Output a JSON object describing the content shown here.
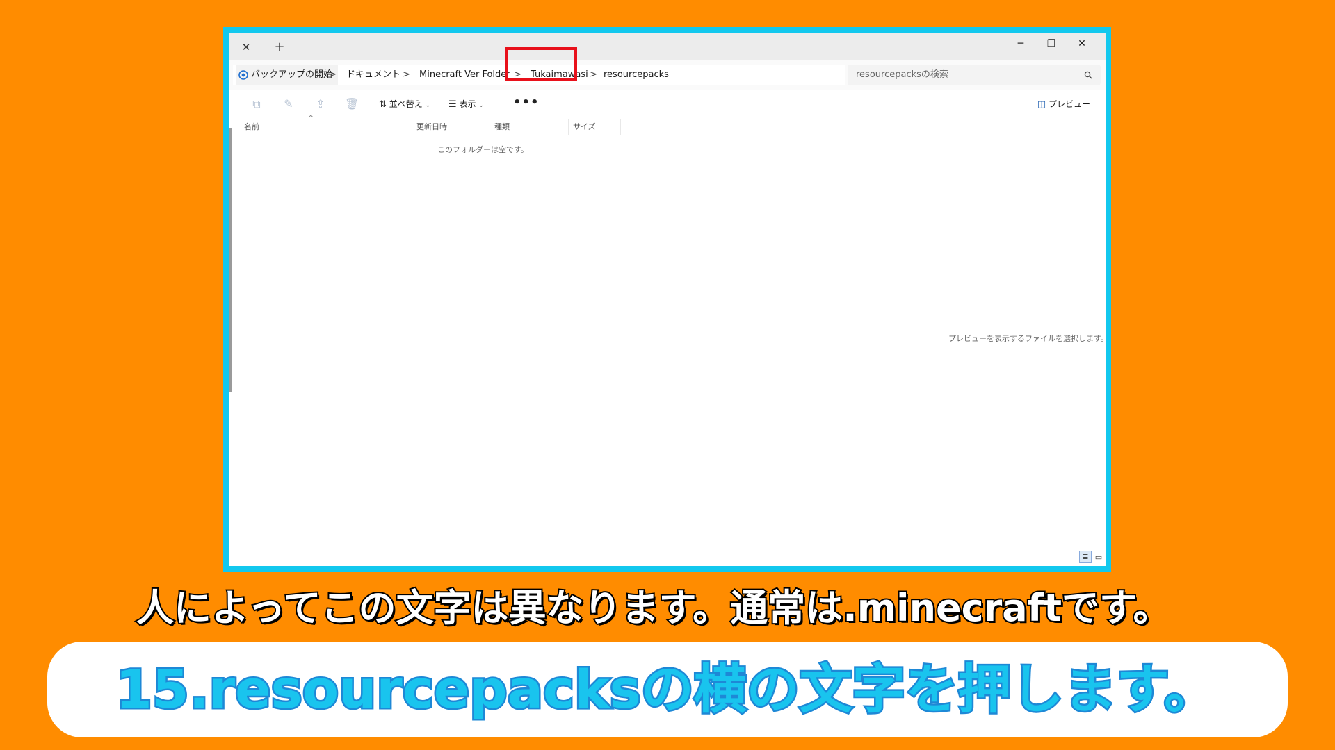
{
  "window": {
    "tab_close": "✕",
    "tab_new": "+",
    "controls": {
      "minimize": "─",
      "maximize": "❐",
      "close": "✕"
    }
  },
  "address": {
    "crumbs": [
      "バックアップの開始",
      "ドキュメント",
      "Minecraft Ver Folder",
      "Tukaimawasi",
      "resourcepacks"
    ],
    "separator": ">",
    "highlighted_crumb": "Tukaimawasi",
    "search_placeholder": "resourcepacksの検索"
  },
  "toolbar": {
    "sort_label": "並べ替え",
    "view_label": "表示",
    "more_label": "•••",
    "preview_label": "プレビュー"
  },
  "columns": [
    "名前",
    "更新日時",
    "種類",
    "サイズ"
  ],
  "empty_message": "このフォルダーは空です。",
  "preview_message": "プレビューを表示するファイルを選択します。",
  "captions": {
    "note": "人によってこの文字は異なります。通常は.minecraftです。",
    "step": "15.resourcepacksの横の文字を押します。"
  },
  "colors": {
    "background": "#FF8C00",
    "window_border": "#12C8EE",
    "highlight_box": "#E8101A",
    "step_text": "#19C4EE"
  }
}
